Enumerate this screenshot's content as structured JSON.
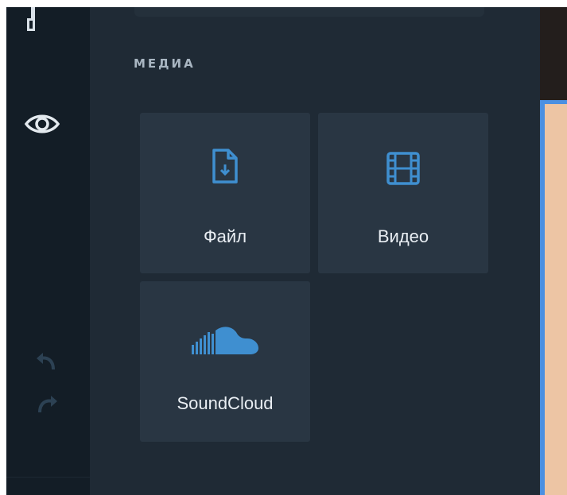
{
  "rail": {
    "icons": [
      "brush-tool-icon",
      "eye-icon",
      "undo-icon",
      "redo-icon"
    ]
  },
  "panel": {
    "section_title": "МЕДИА",
    "tiles": [
      {
        "label": "Файл",
        "icon": "file-download-icon"
      },
      {
        "label": "Видео",
        "icon": "film-icon"
      },
      {
        "label": "SoundCloud",
        "icon": "soundcloud-icon"
      }
    ]
  },
  "colors": {
    "rail_bg": "#131d26",
    "panel_bg": "#1f2a35",
    "tile_bg": "#293643",
    "icon_blue": "#3f8fd0",
    "canvas_bg": "#edc5a4",
    "selection_blue": "#4a90e2"
  }
}
